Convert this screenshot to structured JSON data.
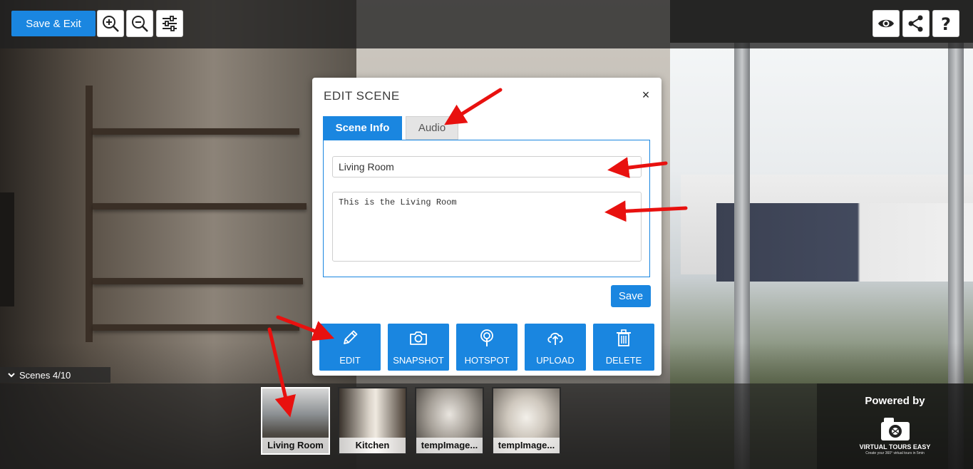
{
  "topbar": {
    "save_exit_label": "Save & Exit",
    "zoom_in_icon": "zoom-in-icon",
    "zoom_out_icon": "zoom-out-icon",
    "settings_icon": "sliders-icon",
    "preview_icon": "eye-icon",
    "share_icon": "share-icon",
    "help_icon": "question-icon"
  },
  "modal": {
    "title": "EDIT SCENE",
    "close_label": "×",
    "tabs": [
      {
        "label": "Scene Info",
        "active": true
      },
      {
        "label": "Audio",
        "active": false
      }
    ],
    "scene_name_value": "Living Room",
    "scene_description_value": "This is the Living Room",
    "save_label": "Save",
    "actions": [
      {
        "label": "EDIT",
        "icon": "pencil-icon"
      },
      {
        "label": "SNAPSHOT",
        "icon": "camera-icon"
      },
      {
        "label": "HOTSPOT",
        "icon": "hotspot-icon"
      },
      {
        "label": "UPLOAD",
        "icon": "cloud-upload-icon"
      },
      {
        "label": "DELETE",
        "icon": "trash-icon"
      }
    ]
  },
  "scenes": {
    "toggle_label": "Scenes 4/10",
    "items": [
      {
        "label": "Living Room",
        "active": true
      },
      {
        "label": "Kitchen",
        "active": false
      },
      {
        "label": "tempImage...",
        "active": false
      },
      {
        "label": "tempImage...",
        "active": false
      }
    ]
  },
  "powered": {
    "text": "Powered by",
    "brand": "VIRTUAL TOURS EASY",
    "tagline": "Create your 360° virtual tours in 5min"
  },
  "colors": {
    "accent": "#1a86e0",
    "annotation": "#e8110f"
  }
}
